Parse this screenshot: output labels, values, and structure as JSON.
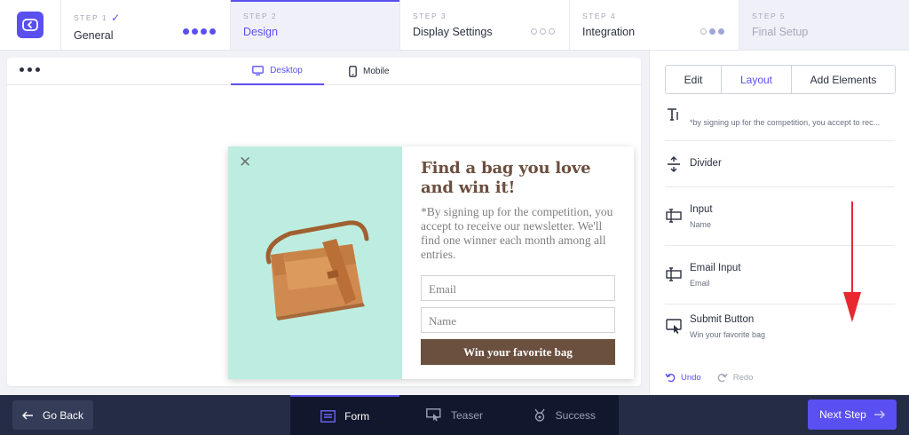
{
  "steps": [
    {
      "kicker": "STEP 1",
      "title": "General",
      "state": "done"
    },
    {
      "kicker": "STEP 2",
      "title": "Design",
      "state": "active"
    },
    {
      "kicker": "STEP 3",
      "title": "Display Settings",
      "state": "todo"
    },
    {
      "kicker": "STEP 4",
      "title": "Integration",
      "state": "todo"
    },
    {
      "kicker": "STEP 5",
      "title": "Final Setup",
      "state": "disabled"
    }
  ],
  "device_tabs": {
    "desktop": "Desktop",
    "mobile": "Mobile"
  },
  "popup": {
    "headline": "Find a bag you love and win it!",
    "description": "*By signing up for the competition, you accept to receive our newsletter. We'll find one winner each month among all entries.",
    "email_placeholder": "Email",
    "name_placeholder": "Name",
    "submit_label": "Win your favorite bag"
  },
  "sidebar": {
    "tabs": {
      "edit": "Edit",
      "layout": "Layout",
      "add": "Add Elements"
    },
    "elements": [
      {
        "name": "",
        "sub": "*by signing up for the competition, you accept to rec...",
        "icon": "text-icon"
      },
      {
        "name": "Divider",
        "sub": "",
        "icon": "divider-icon"
      },
      {
        "name": "Input",
        "sub": "Name",
        "icon": "input-icon"
      },
      {
        "name": "Email Input",
        "sub": "Email",
        "icon": "email-input-icon"
      },
      {
        "name": "Submit Button",
        "sub": "Win your favorite bag",
        "icon": "submit-button-icon"
      }
    ],
    "undo": "Undo",
    "redo": "Redo"
  },
  "bottom": {
    "go_back": "Go Back",
    "modes": {
      "form": "Form",
      "teaser": "Teaser",
      "success": "Success"
    },
    "next": "Next Step"
  },
  "colors": {
    "accent": "#5a4ff0",
    "popup_brown": "#6b4f3f",
    "popup_mint": "#bdede1",
    "bottom_bar": "#252c46"
  }
}
